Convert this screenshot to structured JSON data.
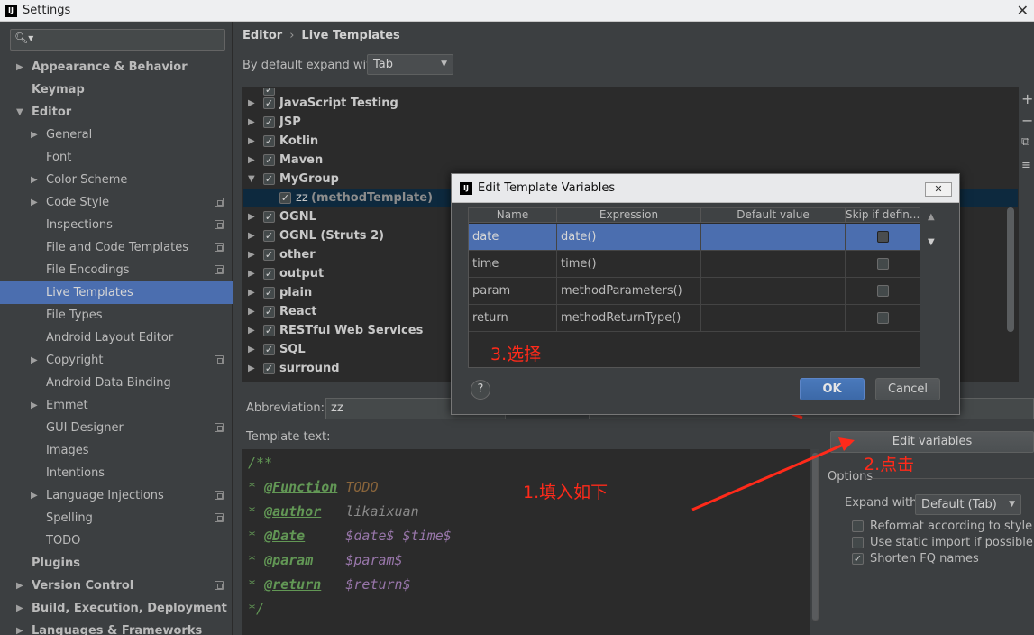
{
  "window": {
    "title": "Settings",
    "app_icon": "intellij-icon"
  },
  "search": {
    "placeholder": ""
  },
  "sidebar": {
    "items": [
      {
        "label": "Appearance & Behavior",
        "bold": true,
        "arrow": "▶",
        "copy": false
      },
      {
        "label": "Keymap",
        "bold": true,
        "arrow": "",
        "copy": false
      },
      {
        "label": "Editor",
        "bold": true,
        "arrow": "▼",
        "copy": false
      },
      {
        "label": "General",
        "bold": false,
        "arrow": "▶",
        "copy": false
      },
      {
        "label": "Font",
        "bold": false,
        "arrow": "",
        "copy": false
      },
      {
        "label": "Color Scheme",
        "bold": false,
        "arrow": "▶",
        "copy": false
      },
      {
        "label": "Code Style",
        "bold": false,
        "arrow": "▶",
        "copy": true
      },
      {
        "label": "Inspections",
        "bold": false,
        "arrow": "",
        "copy": true
      },
      {
        "label": "File and Code Templates",
        "bold": false,
        "arrow": "",
        "copy": true
      },
      {
        "label": "File Encodings",
        "bold": false,
        "arrow": "",
        "copy": true
      },
      {
        "label": "Live Templates",
        "bold": false,
        "arrow": "",
        "copy": false,
        "selected": true
      },
      {
        "label": "File Types",
        "bold": false,
        "arrow": "",
        "copy": false
      },
      {
        "label": "Android Layout Editor",
        "bold": false,
        "arrow": "",
        "copy": false
      },
      {
        "label": "Copyright",
        "bold": false,
        "arrow": "▶",
        "copy": true
      },
      {
        "label": "Android Data Binding",
        "bold": false,
        "arrow": "",
        "copy": false
      },
      {
        "label": "Emmet",
        "bold": false,
        "arrow": "▶",
        "copy": false
      },
      {
        "label": "GUI Designer",
        "bold": false,
        "arrow": "",
        "copy": true
      },
      {
        "label": "Images",
        "bold": false,
        "arrow": "",
        "copy": false
      },
      {
        "label": "Intentions",
        "bold": false,
        "arrow": "",
        "copy": false
      },
      {
        "label": "Language Injections",
        "bold": false,
        "arrow": "▶",
        "copy": true
      },
      {
        "label": "Spelling",
        "bold": false,
        "arrow": "",
        "copy": true
      },
      {
        "label": "TODO",
        "bold": false,
        "arrow": "",
        "copy": false
      },
      {
        "label": "Plugins",
        "bold": true,
        "arrow": "",
        "copy": false
      },
      {
        "label": "Version Control",
        "bold": true,
        "arrow": "▶",
        "copy": true
      },
      {
        "label": "Build, Execution, Deployment",
        "bold": true,
        "arrow": "▶",
        "copy": false
      },
      {
        "label": "Languages & Frameworks",
        "bold": true,
        "arrow": "▶",
        "copy": false
      }
    ]
  },
  "breadcrumb": {
    "parent": "Editor",
    "separator": "›",
    "current": "Live Templates"
  },
  "expand": {
    "label": "By default expand with",
    "value": "Tab"
  },
  "template_groups": [
    {
      "label": "JavaScript Testing",
      "arrow": "▶",
      "checked": true
    },
    {
      "label": "JSP",
      "arrow": "▶",
      "checked": true
    },
    {
      "label": "Kotlin",
      "arrow": "▶",
      "checked": true
    },
    {
      "label": "Maven",
      "arrow": "▶",
      "checked": true
    },
    {
      "label": "MyGroup",
      "arrow": "▼",
      "checked": true
    },
    {
      "label": "zz",
      "desc": "(methodTemplate)",
      "child": true,
      "checked": true
    },
    {
      "label": "OGNL",
      "arrow": "▶",
      "checked": true
    },
    {
      "label": "OGNL (Struts 2)",
      "arrow": "▶",
      "checked": true
    },
    {
      "label": "other",
      "arrow": "▶",
      "checked": true
    },
    {
      "label": "output",
      "arrow": "▶",
      "checked": true
    },
    {
      "label": "plain",
      "arrow": "▶",
      "checked": true
    },
    {
      "label": "React",
      "arrow": "▶",
      "checked": true
    },
    {
      "label": "RESTful Web Services",
      "arrow": "▶",
      "checked": true
    },
    {
      "label": "SQL",
      "arrow": "▶",
      "checked": true
    },
    {
      "label": "surround",
      "arrow": "▶",
      "checked": true
    }
  ],
  "side_tools": [
    "+",
    "−",
    "⧉",
    "≡"
  ],
  "abbreviation": {
    "label": "Abbreviation:",
    "value": "zz"
  },
  "template_text": {
    "label": "Template text:",
    "l1": "/**",
    "star": "*",
    "tag1": "@Function",
    "v1": "TODO",
    "tag2": "@author",
    "v2": "likaixuan",
    "tag3": "@Date",
    "v3": "$date$ $time$",
    "tag4": "@param",
    "v4": "$param$",
    "tag5": "@return",
    "v5": "$return$",
    "l7": "*/"
  },
  "edit_variables_button": "Edit variables",
  "options": {
    "title": "Options",
    "expand_label": "Expand with",
    "expand_value": "Default (Tab)",
    "reformat": {
      "label": "Reformat according to style",
      "checked": false
    },
    "static_import": {
      "label": "Use static import if possible",
      "checked": false
    },
    "shorten_fq": {
      "label": "Shorten FQ names",
      "checked": true
    }
  },
  "dialog": {
    "title": "Edit Template Variables",
    "columns": [
      "Name",
      "Expression",
      "Default value",
      "Skip if defin..."
    ],
    "rows": [
      {
        "name": "date",
        "expression": "date()",
        "default": "",
        "skip": false
      },
      {
        "name": "time",
        "expression": "time()",
        "default": "",
        "skip": false
      },
      {
        "name": "param",
        "expression": "methodParameters()",
        "default": "",
        "skip": false
      },
      {
        "name": "return",
        "expression": "methodReturnType()",
        "default": "",
        "skip": false
      }
    ],
    "help": "?",
    "ok": "OK",
    "cancel": "Cancel"
  },
  "annotations": {
    "fill": "1.填入如下",
    "click": "2.点击",
    "choose": "3.选择",
    "color": "#ff2a1a"
  },
  "colors": {
    "selection": "#4b6eaf",
    "background": "#3c3f41",
    "editor": "#2b2b2b"
  }
}
